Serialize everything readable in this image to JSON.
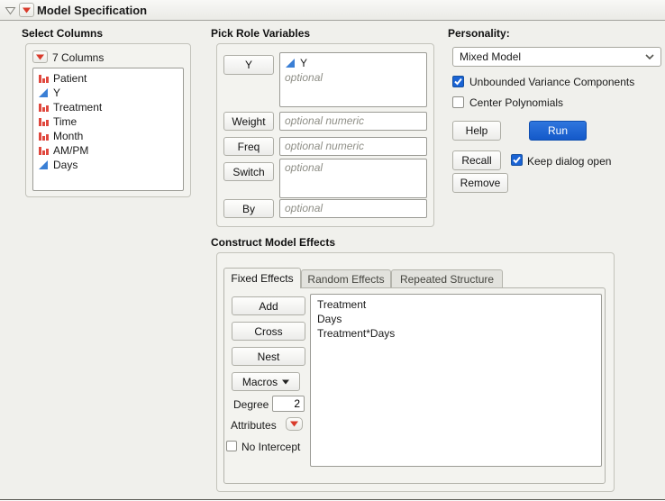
{
  "window": {
    "title": "Model Specification"
  },
  "colors": {
    "run_button_blue": "#1a63d4",
    "checkbox_checked_blue": "#1a63d4",
    "red_triangle": "#d93a2b",
    "nominal_icon_red": "#e0483e",
    "continuous_icon_blue": "#3a7fd5"
  },
  "icons": {
    "disclosure": "open-triangle-down",
    "red_triangle_menu": "red-triangle-down",
    "nominal": "red-bar-chart",
    "continuous": "blue-ramp-triangle",
    "dropdown_chevron": "chevron-down",
    "check": "check-mark",
    "macros_arrow": "triangle-down"
  },
  "select_columns": {
    "title": "Select Columns",
    "count_label": "7 Columns",
    "columns": [
      {
        "name": "Patient",
        "type": "nominal"
      },
      {
        "name": "Y",
        "type": "continuous"
      },
      {
        "name": "Treatment",
        "type": "nominal"
      },
      {
        "name": "Time",
        "type": "nominal"
      },
      {
        "name": "Month",
        "type": "nominal"
      },
      {
        "name": "AM/PM",
        "type": "nominal"
      },
      {
        "name": "Days",
        "type": "continuous"
      }
    ]
  },
  "pick_roles": {
    "title": "Pick Role Variables",
    "y_button": "Y",
    "y_value": "Y",
    "y_placeholder": "optional",
    "weight_button": "Weight",
    "weight_placeholder": "optional numeric",
    "freq_button": "Freq",
    "freq_placeholder": "optional numeric",
    "switch_button": "Switch",
    "switch_placeholder": "optional",
    "by_button": "By",
    "by_placeholder": "optional"
  },
  "personality": {
    "label": "Personality:",
    "selected": "Mixed Model",
    "checkbox_unbounded": {
      "label": "Unbounded Variance Components",
      "checked": true
    },
    "checkbox_center": {
      "label": "Center Polynomials",
      "checked": false
    },
    "help_button": "Help",
    "run_button": "Run",
    "recall_button": "Recall",
    "keep_dialog_checkbox": {
      "label": "Keep dialog open",
      "checked": true
    },
    "remove_button": "Remove"
  },
  "model_effects": {
    "title": "Construct Model Effects",
    "tabs": [
      {
        "label": "Fixed Effects",
        "active": true
      },
      {
        "label": "Random Effects",
        "active": false
      },
      {
        "label": "Repeated Structure",
        "active": false
      }
    ],
    "add_button": "Add",
    "cross_button": "Cross",
    "nest_button": "Nest",
    "macros_button": "Macros",
    "degree_label": "Degree",
    "degree_value": "2",
    "attributes_label": "Attributes",
    "no_intercept_checkbox": {
      "label": "No Intercept",
      "checked": false
    },
    "effects": [
      "Treatment",
      "Days",
      "Treatment*Days"
    ]
  }
}
